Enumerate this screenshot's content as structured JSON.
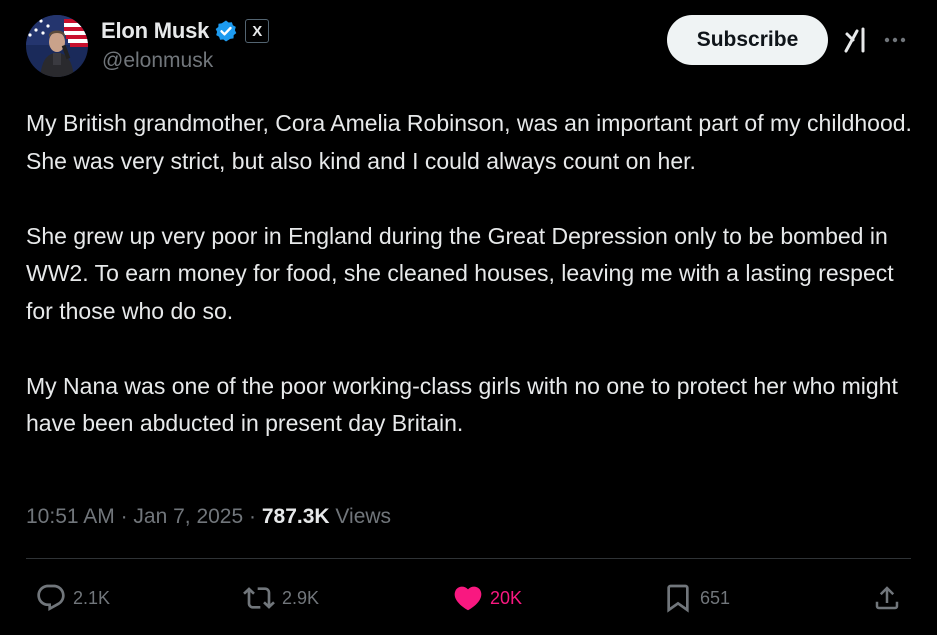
{
  "author": {
    "display_name": "Elon Musk",
    "handle": "@elonmusk",
    "verified_icon": "verified-badge",
    "affiliation_badge": "X"
  },
  "header": {
    "subscribe_label": "Subscribe",
    "grok_icon": "grok-icon",
    "more_icon": "more-icon"
  },
  "tweet": {
    "paragraphs": [
      "My British grandmother, Cora Amelia Robinson, was an important part of my childhood. She was very strict, but also kind and I could always count on her.",
      "She grew up very poor in England during the Great Depression only to be bombed in WW2. To earn money for food, she cleaned houses, leaving me with a lasting respect for those who do so.",
      "My Nana was one of the poor working-class girls with no one to protect her who might have been abducted in present day Britain."
    ]
  },
  "meta": {
    "time": "10:51 AM",
    "separator": " · ",
    "date": "Jan 7, 2025",
    "views_count": "787.3K",
    "views_label": " Views"
  },
  "actions": {
    "replies": "2.1K",
    "reposts": "2.9K",
    "likes": "20K",
    "bookmarks": "651"
  },
  "colors": {
    "background": "#000000",
    "text": "#e7e9ea",
    "secondary": "#71767b",
    "like_pink": "#f91880",
    "verified_blue": "#1d9bf0"
  }
}
